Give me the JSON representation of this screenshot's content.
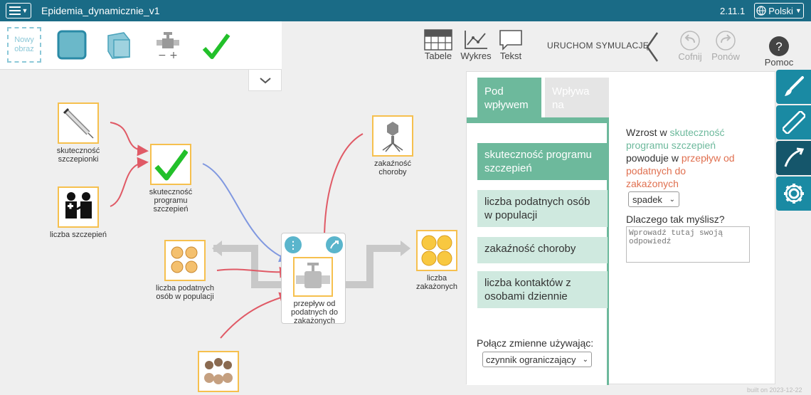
{
  "header": {
    "title": "Epidemia_dynamicznie_v1",
    "version": "2.11.1",
    "language": "Polski"
  },
  "toolbar": {
    "new_image": "Nowy obraz",
    "tables": "Tabele",
    "graph": "Wykres",
    "text": "Tekst",
    "run": "URUCHOM SYMULACJĘ",
    "undo": "Cofnij",
    "redo": "Ponów",
    "help": "Pomoc"
  },
  "nodes": {
    "vaccine_effectiveness": "skuteczność szczepionki",
    "program_effectiveness": "skuteczność programu szczepień",
    "vaccination_count": "liczba szczepień",
    "infectiousness": "zakaźność choroby",
    "susceptible": "liczba podatnych osób w populacji",
    "flow": "przepływ od podatnych do zakażonych",
    "infected": "liczba zakażonych"
  },
  "panel": {
    "tab_active": "Pod wpływem",
    "tab_inactive": "Wpływa na",
    "variables": [
      "skuteczność programu szczepień",
      "liczba podatnych osób w populacji",
      "zakaźność choroby",
      "liczba kontaktów z osobami dziennie"
    ],
    "connect_label": "Połącz zmienne używając:",
    "connect_value": "czynnik ograniczający",
    "relation_prefix": "Wzrost w",
    "relation_source": "skuteczność programu szczepień",
    "relation_mid": "powoduje w",
    "relation_target": "przepływ od podatnych do zakażonych",
    "effect_value": "spadek",
    "why_label": "Dlaczego tak myślisz?",
    "why_placeholder": "Wprowadź tutaj swoją odpowiedź"
  },
  "footer": {
    "built": "built on 2023-12-22"
  },
  "colors": {
    "header": "#1a6b86",
    "accent_green": "#6db99c",
    "node_border": "#f6c04e",
    "link_red": "#e05a66",
    "link_blue": "#8098e0"
  }
}
